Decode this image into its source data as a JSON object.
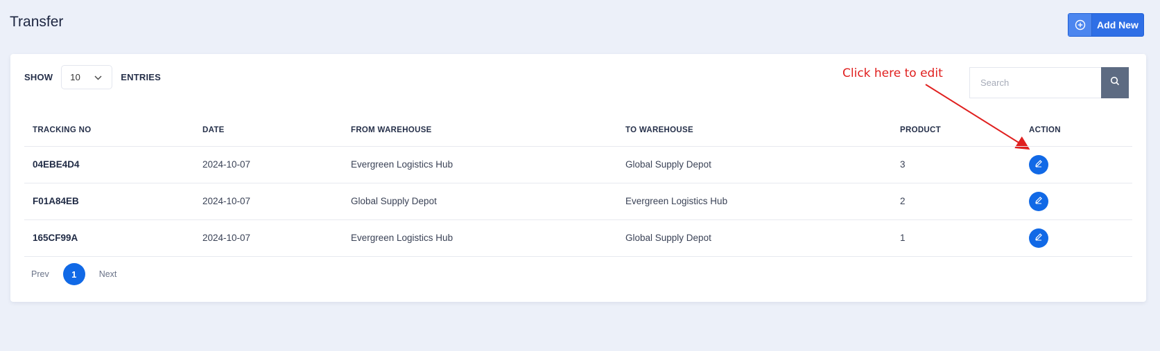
{
  "page": {
    "title": "Transfer"
  },
  "header": {
    "add_new_label": "Add New",
    "add_new_icon": "plus-circle-icon"
  },
  "controls": {
    "show_label": "SHOW",
    "entries_value": "10",
    "entries_label": "ENTRIES",
    "search_placeholder": "Search"
  },
  "annotation": {
    "text": "Click here to edit",
    "color": "#e0201f"
  },
  "table": {
    "columns": [
      "TRACKING NO",
      "DATE",
      "FROM WAREHOUSE",
      "TO WAREHOUSE",
      "PRODUCT",
      "ACTION"
    ],
    "rows": [
      {
        "tracking_no": "04EBE4D4",
        "date": "2024-10-07",
        "from": "Evergreen Logistics Hub",
        "to": "Global Supply Depot",
        "product": "3"
      },
      {
        "tracking_no": "F01A84EB",
        "date": "2024-10-07",
        "from": "Global Supply Depot",
        "to": "Evergreen Logistics Hub",
        "product": "2"
      },
      {
        "tracking_no": "165CF99A",
        "date": "2024-10-07",
        "from": "Evergreen Logistics Hub",
        "to": "Global Supply Depot",
        "product": "1"
      }
    ]
  },
  "pagination": {
    "prev_label": "Prev",
    "current_page": "1",
    "next_label": "Next"
  },
  "colors": {
    "primary": "#1169e6",
    "background": "#ecf0f9",
    "search_button": "#5d6b82"
  }
}
